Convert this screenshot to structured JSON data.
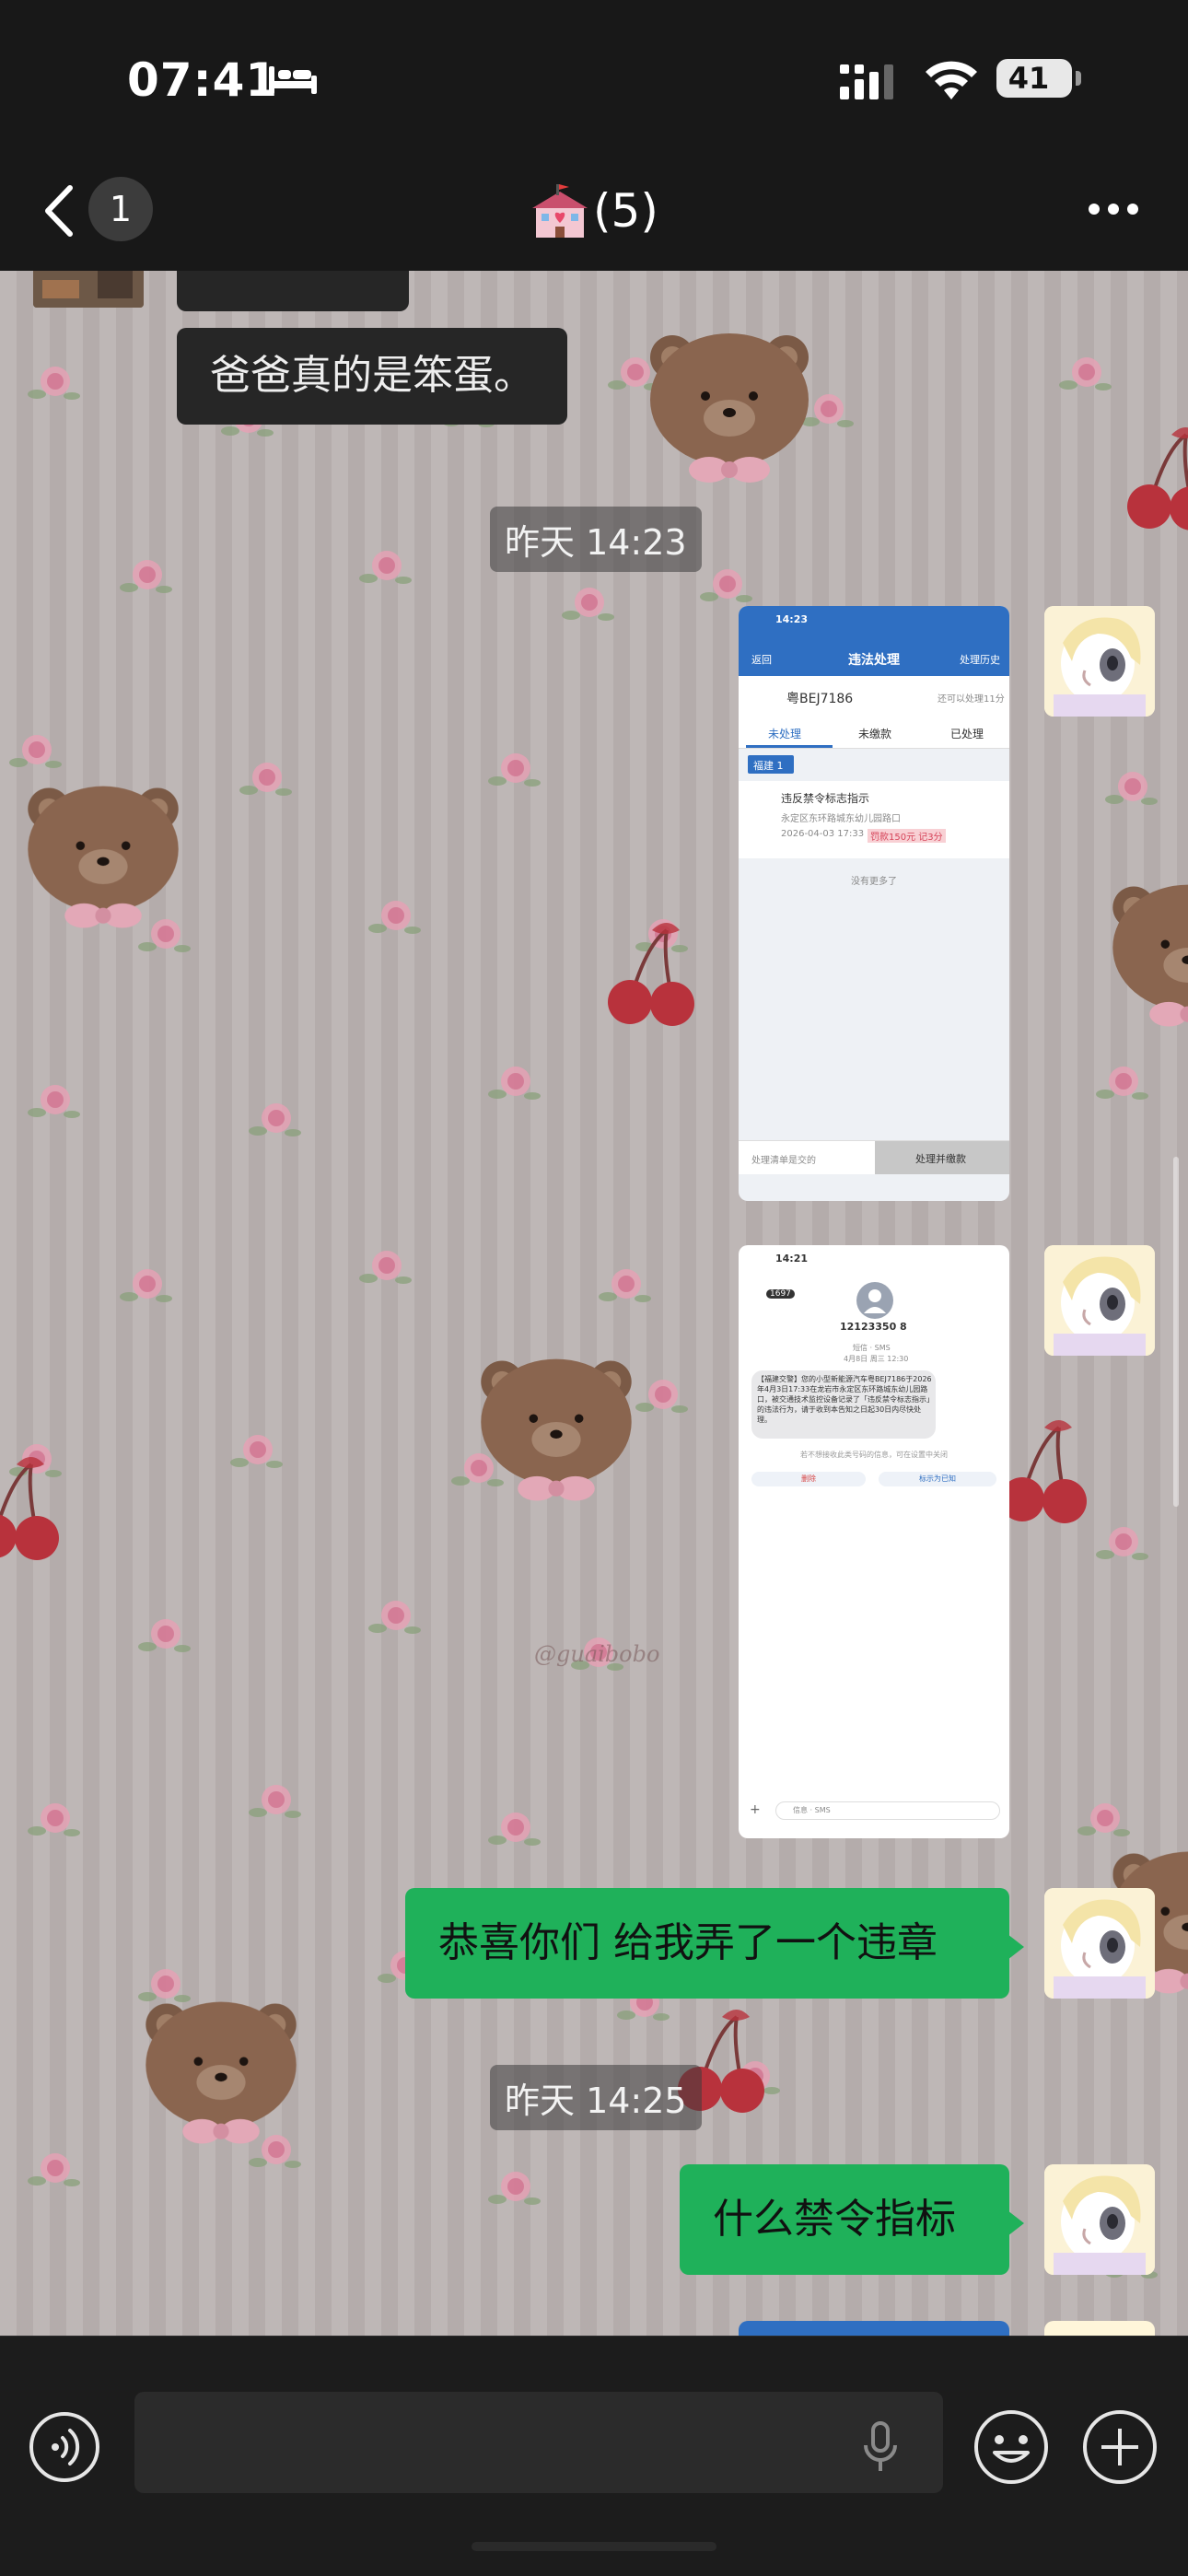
{
  "status_bar": {
    "time": "07:41",
    "battery": "41",
    "icons": [
      "bed-icon",
      "signal-icon",
      "wifi-icon",
      "battery-icon"
    ]
  },
  "nav": {
    "unread_count": "1",
    "title": "(5)",
    "title_icon": "school-icon"
  },
  "messages": [
    {
      "type": "text",
      "direction": "in",
      "text": "爸爸真的是笨蛋。"
    },
    {
      "type": "timestamp",
      "text": "昨天 14:23"
    },
    {
      "type": "image",
      "direction": "out"
    },
    {
      "type": "image",
      "direction": "out"
    },
    {
      "type": "text",
      "direction": "out",
      "text": "恭喜你们 给我弄了一个违章"
    },
    {
      "type": "timestamp",
      "text": "昨天 14:25"
    },
    {
      "type": "text",
      "direction": "out",
      "text": "什么禁令指标"
    }
  ],
  "shot1": {
    "time": "14:23",
    "back": "返回",
    "title": "违法处理",
    "history": "处理历史",
    "plate": "粤BEJ7186",
    "tip": "还可以处理11分",
    "tabs": [
      "未处理",
      "未缴款",
      "已处理"
    ],
    "tag": "福建 1",
    "violation_title": "违反禁令标志指示",
    "violation_place": "永定区东环路城东幼儿园路口",
    "violation_date": "2026-04-03 17:33",
    "violation_badge": "罚款150元 记3分",
    "no_more": "没有更多了",
    "bottom_left": "处理清单是交的",
    "bottom_right": "处理并缴款"
  },
  "shot2": {
    "time": "14:21",
    "badge": "1697",
    "number": "12123350 8",
    "sub1": "短信 · SMS",
    "sub2": "4月8日 周三 12:30",
    "sms_text": "【福建交警】您的小型新能源汽车粤BEJ7186于2026年4月3日17:33在龙岩市永定区东环路城东幼儿园路口，被交通技术监控设备记录了「违反禁令标志指示」的违法行为，请于收到本告知之日起30日内尽快处理。",
    "note": "若不想接收此类号码的信息，可在设置中关闭",
    "delete": "删除",
    "mark_read": "标示为已知",
    "input_placeholder": "信息 · SMS"
  },
  "watermark": "@guaibobo",
  "input": {
    "placeholder": ""
  }
}
